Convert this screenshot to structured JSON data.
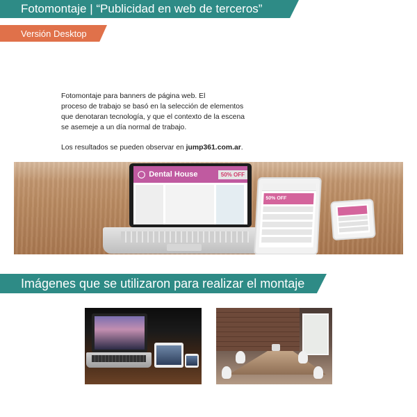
{
  "header": {
    "title": "Fotomontaje | “Publicidad en web de terceros”",
    "subtitle": "Versión Desktop"
  },
  "description": {
    "line1": "Fotomontaje para banners de página web. El",
    "line2": "proceso de trabajo se basó en la selección de elementos",
    "line3": "que denotaran tecnología, y que el contexto de la escena",
    "line4": "se asemeje a un día normal de trabajo.",
    "results_prefix": "Los resultados se pueden observar en ",
    "results_link": "jump361.com.ar",
    "results_suffix": "."
  },
  "hero": {
    "site_name": "Dental House",
    "site_offer": "50% OFF",
    "tablet_offer": "50% OFF"
  },
  "section2": {
    "title": "Imágenes que se utilizaron para realizar el montaje"
  },
  "colors": {
    "teal": "#2e8b86",
    "orange": "#e0714a",
    "magenta": "#c05aa0"
  }
}
